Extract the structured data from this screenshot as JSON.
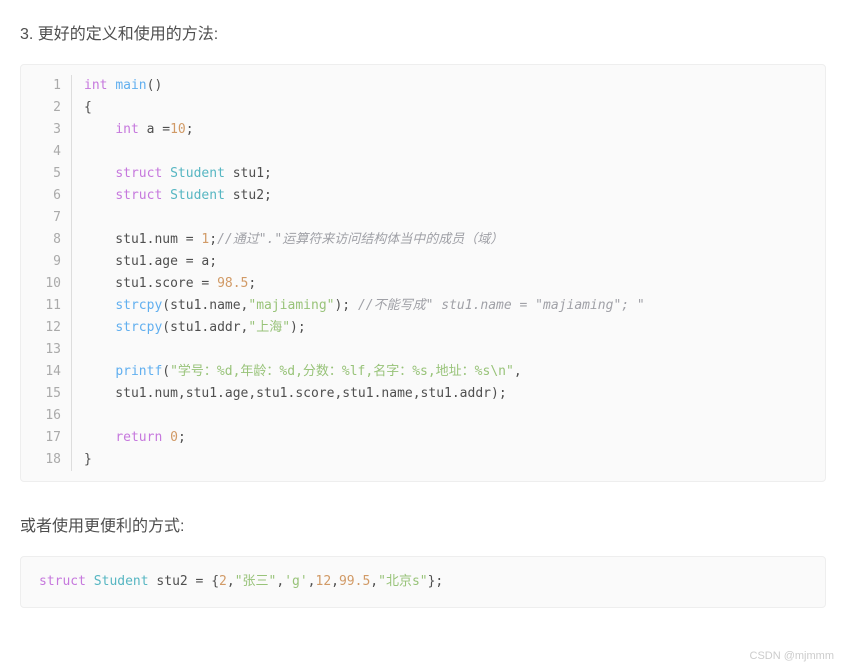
{
  "heading": "3. 更好的定义和使用的方法:",
  "code1": {
    "lines": [
      [
        {
          "cls": "tok-key",
          "t": "int"
        },
        {
          "cls": "tok-ident",
          "t": " "
        },
        {
          "cls": "tok-func",
          "t": "main"
        },
        {
          "cls": "tok-punc",
          "t": "()"
        }
      ],
      [
        {
          "cls": "tok-punc",
          "t": "{"
        }
      ],
      [
        {
          "cls": "tok-ident",
          "t": "    "
        },
        {
          "cls": "tok-key",
          "t": "int"
        },
        {
          "cls": "tok-ident",
          "t": " a ="
        },
        {
          "cls": "tok-num",
          "t": "10"
        },
        {
          "cls": "tok-punc",
          "t": ";"
        }
      ],
      [
        {
          "cls": "tok-ident",
          "t": ""
        }
      ],
      [
        {
          "cls": "tok-ident",
          "t": "    "
        },
        {
          "cls": "tok-key",
          "t": "struct"
        },
        {
          "cls": "tok-ident",
          "t": " "
        },
        {
          "cls": "tok-type",
          "t": "Student"
        },
        {
          "cls": "tok-ident",
          "t": " stu1;"
        }
      ],
      [
        {
          "cls": "tok-ident",
          "t": "    "
        },
        {
          "cls": "tok-key",
          "t": "struct"
        },
        {
          "cls": "tok-ident",
          "t": " "
        },
        {
          "cls": "tok-type",
          "t": "Student"
        },
        {
          "cls": "tok-ident",
          "t": " stu2;"
        }
      ],
      [
        {
          "cls": "tok-ident",
          "t": ""
        }
      ],
      [
        {
          "cls": "tok-ident",
          "t": "    stu1.num = "
        },
        {
          "cls": "tok-num",
          "t": "1"
        },
        {
          "cls": "tok-punc",
          "t": ";"
        },
        {
          "cls": "tok-comment",
          "t": "//通过\".\"运算符来访问结构体当中的成员（域）"
        }
      ],
      [
        {
          "cls": "tok-ident",
          "t": "    stu1.age = a;"
        }
      ],
      [
        {
          "cls": "tok-ident",
          "t": "    stu1.score = "
        },
        {
          "cls": "tok-num",
          "t": "98.5"
        },
        {
          "cls": "tok-punc",
          "t": ";"
        }
      ],
      [
        {
          "cls": "tok-ident",
          "t": "    "
        },
        {
          "cls": "tok-func",
          "t": "strcpy"
        },
        {
          "cls": "tok-punc",
          "t": "(stu1.name,"
        },
        {
          "cls": "tok-str",
          "t": "\"majiaming\""
        },
        {
          "cls": "tok-punc",
          "t": "); "
        },
        {
          "cls": "tok-comment",
          "t": "//不能写成\" stu1.name = \"majiaming\"; \""
        }
      ],
      [
        {
          "cls": "tok-ident",
          "t": "    "
        },
        {
          "cls": "tok-func",
          "t": "strcpy"
        },
        {
          "cls": "tok-punc",
          "t": "(stu1.addr,"
        },
        {
          "cls": "tok-str",
          "t": "\"上海\""
        },
        {
          "cls": "tok-punc",
          "t": ");"
        }
      ],
      [
        {
          "cls": "tok-ident",
          "t": ""
        }
      ],
      [
        {
          "cls": "tok-ident",
          "t": "    "
        },
        {
          "cls": "tok-func",
          "t": "printf"
        },
        {
          "cls": "tok-punc",
          "t": "("
        },
        {
          "cls": "tok-str",
          "t": "\"学号：%d,年龄：%d,分数：%lf,名字：%s,地址：%s\\n\""
        },
        {
          "cls": "tok-punc",
          "t": ","
        }
      ],
      [
        {
          "cls": "tok-ident",
          "t": "    stu1.num,stu1.age,stu1.score,stu1.name,stu1.addr);"
        }
      ],
      [
        {
          "cls": "tok-ident",
          "t": ""
        }
      ],
      [
        {
          "cls": "tok-ident",
          "t": "    "
        },
        {
          "cls": "tok-key",
          "t": "return"
        },
        {
          "cls": "tok-ident",
          "t": " "
        },
        {
          "cls": "tok-num",
          "t": "0"
        },
        {
          "cls": "tok-punc",
          "t": ";"
        }
      ],
      [
        {
          "cls": "tok-punc",
          "t": "}"
        }
      ]
    ]
  },
  "subtext": "或者使用更便利的方式:",
  "code2": {
    "tokens": [
      {
        "cls": "tok-key",
        "t": "struct"
      },
      {
        "cls": "tok-ident",
        "t": " "
      },
      {
        "cls": "tok-type",
        "t": "Student"
      },
      {
        "cls": "tok-ident",
        "t": " stu2 = {"
      },
      {
        "cls": "tok-num",
        "t": "2"
      },
      {
        "cls": "tok-punc",
        "t": ","
      },
      {
        "cls": "tok-str",
        "t": "\"张三\""
      },
      {
        "cls": "tok-punc",
        "t": ","
      },
      {
        "cls": "tok-str",
        "t": "'g'"
      },
      {
        "cls": "tok-punc",
        "t": ","
      },
      {
        "cls": "tok-num",
        "t": "12"
      },
      {
        "cls": "tok-punc",
        "t": ","
      },
      {
        "cls": "tok-num",
        "t": "99.5"
      },
      {
        "cls": "tok-punc",
        "t": ","
      },
      {
        "cls": "tok-str",
        "t": "\"北京s\""
      },
      {
        "cls": "tok-punc",
        "t": "};"
      }
    ]
  },
  "watermark": "CSDN @mjmmm"
}
